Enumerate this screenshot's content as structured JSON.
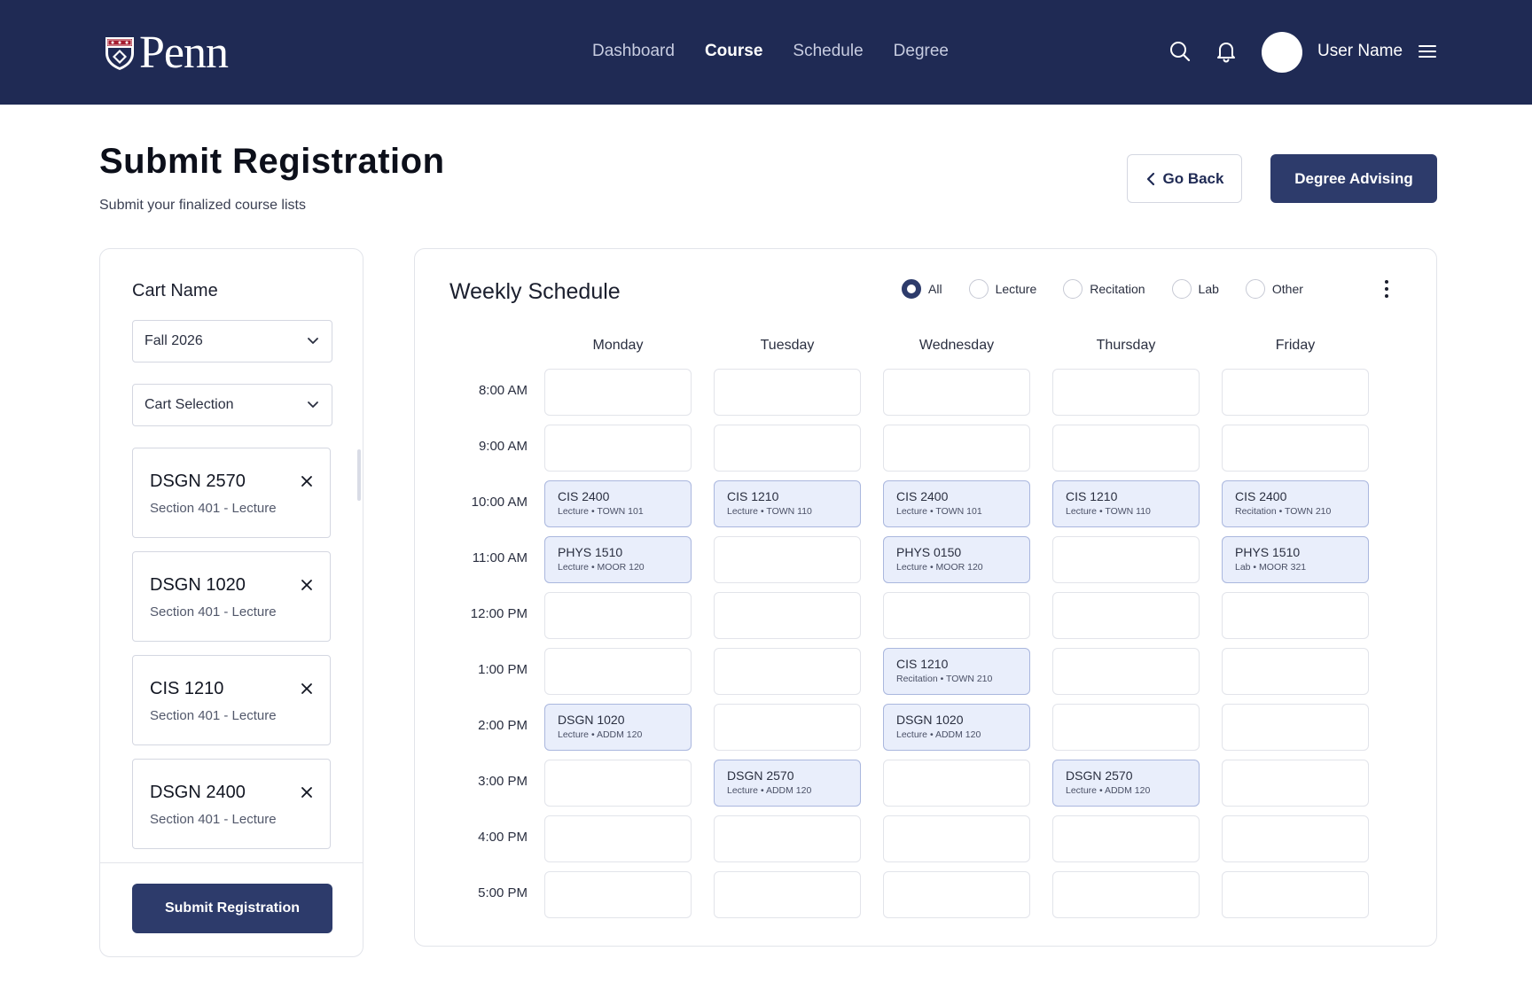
{
  "nav": {
    "logo_text": "Penn",
    "links": [
      "Dashboard",
      "Course",
      "Schedule",
      "Degree"
    ],
    "active": "Course",
    "user_name": "User Name",
    "icons": [
      "search-icon",
      "bell-icon",
      "menu-icon"
    ]
  },
  "header": {
    "title": "Submit Registration",
    "subtitle": "Submit your finalized course lists",
    "back_label": "Go Back",
    "advising_label": "Degree Advising"
  },
  "cart": {
    "label": "Cart Name",
    "term_value": "Fall 2026",
    "selection_value": "Cart Selection",
    "items": [
      {
        "code": "DSGN 2570",
        "section": "Section 401 - Lecture"
      },
      {
        "code": "DSGN 1020",
        "section": "Section 401 - Lecture"
      },
      {
        "code": "CIS 1210",
        "section": "Section 401 - Lecture"
      },
      {
        "code": "DSGN 2400",
        "section": "Section 401 - Lecture"
      }
    ],
    "submit_label": "Submit Registration"
  },
  "schedule": {
    "title": "Weekly Schedule",
    "filters": [
      "All",
      "Lecture",
      "Recitation",
      "Lab",
      "Other"
    ],
    "selected_filter": "All",
    "days": [
      "Monday",
      "Tuesday",
      "Wednesday",
      "Thursday",
      "Friday"
    ],
    "times": [
      "8:00 AM",
      "9:00 AM",
      "10:00 AM",
      "11:00 AM",
      "12:00 PM",
      "1:00 PM",
      "2:00 PM",
      "3:00 PM",
      "4:00 PM",
      "5:00 PM"
    ],
    "events": [
      {
        "day": 0,
        "time": 2,
        "code": "CIS 2400",
        "meta": "Lecture • TOWN 101"
      },
      {
        "day": 1,
        "time": 2,
        "code": "CIS 1210",
        "meta": "Lecture • TOWN 110"
      },
      {
        "day": 2,
        "time": 2,
        "code": "CIS 2400",
        "meta": "Lecture • TOWN 101"
      },
      {
        "day": 3,
        "time": 2,
        "code": "CIS 1210",
        "meta": "Lecture • TOWN 110"
      },
      {
        "day": 4,
        "time": 2,
        "code": "CIS 2400",
        "meta": "Recitation • TOWN 210"
      },
      {
        "day": 0,
        "time": 3,
        "code": "PHYS 1510",
        "meta": "Lecture • MOOR 120"
      },
      {
        "day": 2,
        "time": 3,
        "code": "PHYS 0150",
        "meta": "Lecture • MOOR 120"
      },
      {
        "day": 4,
        "time": 3,
        "code": "PHYS 1510",
        "meta": "Lab • MOOR 321"
      },
      {
        "day": 2,
        "time": 5,
        "code": "CIS 1210",
        "meta": "Recitation • TOWN 210"
      },
      {
        "day": 0,
        "time": 6,
        "code": "DSGN 1020",
        "meta": "Lecture • ADDM 120"
      },
      {
        "day": 2,
        "time": 6,
        "code": "DSGN 1020",
        "meta": "Lecture • ADDM 120"
      },
      {
        "day": 1,
        "time": 7,
        "code": "DSGN 2570",
        "meta": "Lecture • ADDM 120"
      },
      {
        "day": 3,
        "time": 7,
        "code": "DSGN 2570",
        "meta": "Lecture • ADDM 120"
      }
    ]
  },
  "colors": {
    "nav_bg": "#1f2a54",
    "primary": "#2d3b6b",
    "event_bg": "#e9eefb",
    "event_border": "#aab7de"
  }
}
